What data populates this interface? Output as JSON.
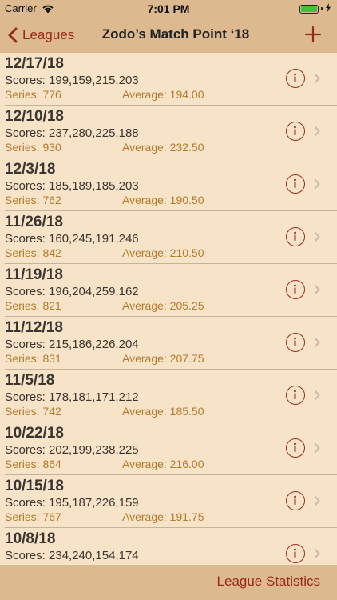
{
  "status_bar": {
    "carrier": "Carrier",
    "time": "7:01 PM",
    "battery_color": "#3cc43c"
  },
  "nav": {
    "back_label": "Leagues",
    "title": "Zodo’s Match Point ‘18",
    "add_icon": "plus-icon"
  },
  "colors": {
    "background": "#f6e3c8",
    "bar": "#dcb98f",
    "accent": "#9b2a1a",
    "meta_text": "#b57a2c"
  },
  "rows": [
    {
      "date": "12/17/18",
      "scores": "Scores: 199,159,215,203",
      "series": "Series: 776",
      "average": "Average: 194.00"
    },
    {
      "date": "12/10/18",
      "scores": "Scores: 237,280,225,188",
      "series": "Series: 930",
      "average": "Average: 232.50"
    },
    {
      "date": "12/3/18",
      "scores": "Scores: 185,189,185,203",
      "series": "Series: 762",
      "average": "Average: 190.50"
    },
    {
      "date": "11/26/18",
      "scores": "Scores: 160,245,191,246",
      "series": "Series: 842",
      "average": "Average: 210.50"
    },
    {
      "date": "11/19/18",
      "scores": "Scores: 196,204,259,162",
      "series": "Series: 821",
      "average": "Average: 205.25"
    },
    {
      "date": "11/12/18",
      "scores": "Scores: 215,186,226,204",
      "series": "Series: 831",
      "average": "Average: 207.75"
    },
    {
      "date": "11/5/18",
      "scores": "Scores: 178,181,171,212",
      "series": "Series: 742",
      "average": "Average: 185.50"
    },
    {
      "date": "10/22/18",
      "scores": "Scores: 202,199,238,225",
      "series": "Series: 864",
      "average": "Average: 216.00"
    },
    {
      "date": "10/15/18",
      "scores": "Scores: 195,187,226,159",
      "series": "Series: 767",
      "average": "Average: 191.75"
    },
    {
      "date": "10/8/18",
      "scores": "Scores: 234,240,154,174",
      "series": "",
      "average": ""
    }
  ],
  "toolbar": {
    "league_stats_label": "League Statistics"
  }
}
